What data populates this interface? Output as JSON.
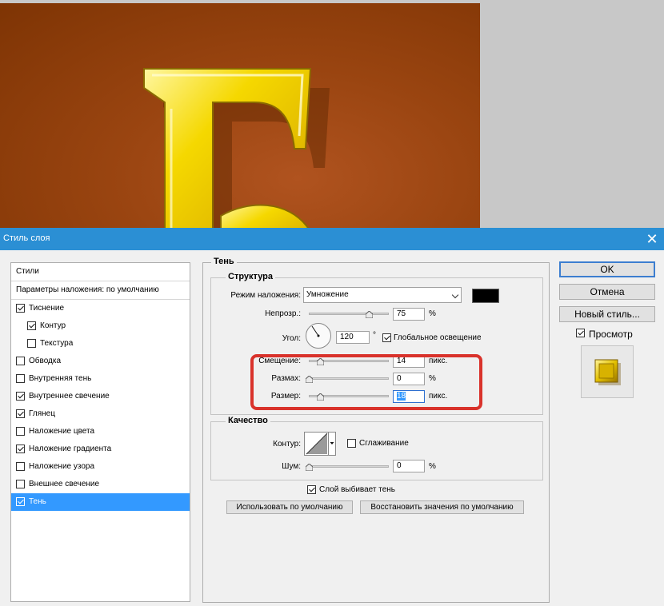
{
  "window": {
    "title": "Стиль слоя"
  },
  "styles_list": {
    "header": "Стили",
    "blending": "Параметры наложения: по умолчанию",
    "items": [
      {
        "label": "Тиснение",
        "checked": true
      },
      {
        "label": "Контур",
        "checked": true
      },
      {
        "label": "Текстура",
        "checked": false
      },
      {
        "label": "Обводка",
        "checked": false
      },
      {
        "label": "Внутренняя тень",
        "checked": false
      },
      {
        "label": "Внутреннее свечение",
        "checked": true
      },
      {
        "label": "Глянец",
        "checked": true
      },
      {
        "label": "Наложение цвета",
        "checked": false
      },
      {
        "label": "Наложение градиента",
        "checked": true
      },
      {
        "label": "Наложение узора",
        "checked": false
      },
      {
        "label": "Внешнее свечение",
        "checked": false
      },
      {
        "label": "Тень",
        "checked": true
      }
    ]
  },
  "shadow": {
    "section": "Тень",
    "structure": {
      "title": "Структура",
      "blend_mode_label": "Режим наложения:",
      "blend_mode_value": "Умножение",
      "shadow_color": "#000000",
      "opacity_label": "Непрозр.:",
      "opacity_value": "75",
      "percent": "%",
      "angle_label": "Угол:",
      "angle_value": "120",
      "degree": "°",
      "global_light_label": "Глобальное освещение",
      "global_light_checked": true,
      "distance_label": "Смещение:",
      "distance_value": "14",
      "distance_unit": "пикс.",
      "spread_label": "Размах:",
      "spread_value": "0",
      "spread_unit": "%",
      "size_label": "Размер:",
      "size_value": "18",
      "size_unit": "пикс."
    },
    "quality": {
      "title": "Качество",
      "contour_label": "Контур:",
      "antialias_label": "Сглаживание",
      "antialias_checked": false,
      "noise_label": "Шум:",
      "noise_value": "0",
      "percent": "%"
    },
    "knockout_label": "Слой выбивает тень",
    "knockout_checked": true,
    "make_default": "Использовать по умолчанию",
    "reset_default": "Восстановить значения по умолчанию"
  },
  "buttons": {
    "ok": "OK",
    "cancel": "Отмена",
    "new_style": "Новый стиль...",
    "preview_label": "Просмотр",
    "preview_checked": true
  },
  "colors": {
    "title_bar": "#2b8fd4",
    "selection": "#3399ff",
    "highlight": "#d9322b",
    "canvas": "#994410",
    "gold": "#f5d800"
  }
}
